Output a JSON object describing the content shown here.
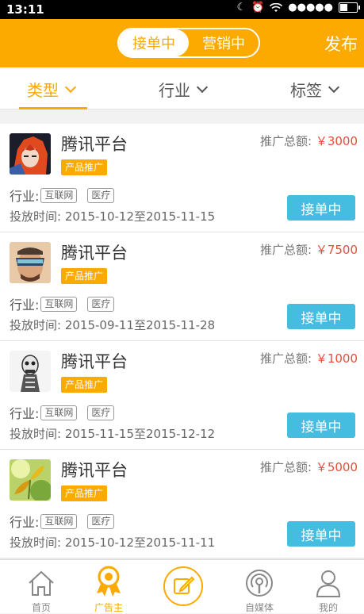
{
  "status_bar": {
    "time": "13:11",
    "signal": "●●●●●"
  },
  "header": {
    "segments": [
      "接单中",
      "营销中"
    ],
    "active_segment": "接单中",
    "publish_label": "发布",
    "accent_color": "#fca900"
  },
  "filters": [
    {
      "label": "类型",
      "active": true
    },
    {
      "label": "行业",
      "active": false
    },
    {
      "label": "标签",
      "active": false
    }
  ],
  "cards": [
    {
      "title": "腾讯平台",
      "tag": "产品推广",
      "amount_label": "推广总额:",
      "amount": "￥3000",
      "industry_label": "行业:",
      "chips": [
        "互联网",
        "医疗"
      ],
      "period": "投放时间:  2015-10-12至2015-11-15",
      "button": "接单中",
      "avatar": "anime-avatar"
    },
    {
      "title": "腾讯平台",
      "tag": "产品推广",
      "amount_label": "推广总额:",
      "amount": "￥7500",
      "industry_label": "行业:",
      "chips": [
        "互联网",
        "医疗"
      ],
      "period": "投放时间:  2015-09-11至2015-11-28",
      "button": "接单中",
      "avatar": "goggles-avatar"
    },
    {
      "title": "腾讯平台",
      "tag": "产品推广",
      "amount_label": "推广总额:",
      "amount": "￥1000",
      "industry_label": "行业:",
      "chips": [
        "互联网",
        "医疗"
      ],
      "period": "投放时间:  2015-11-15至2015-12-12",
      "button": "接单中",
      "avatar": "skull-avatar"
    },
    {
      "title": "腾讯平台",
      "tag": "产品推广",
      "amount_label": "推广总额:",
      "amount": "￥5000",
      "industry_label": "行业:",
      "chips": [
        "互联网",
        "医疗"
      ],
      "period": "投放时间:  2015-10-12至2015-11-11",
      "button": "接单中",
      "avatar": "flower-avatar"
    }
  ],
  "tabbar": [
    {
      "label": "首页",
      "icon": "home-icon",
      "active": false
    },
    {
      "label": "广告主",
      "icon": "award-icon",
      "active": true
    },
    {
      "label": "",
      "icon": "edit-icon",
      "active": false
    },
    {
      "label": "自媒体",
      "icon": "broadcast-icon",
      "active": false
    },
    {
      "label": "我的",
      "icon": "user-icon",
      "active": false
    }
  ]
}
